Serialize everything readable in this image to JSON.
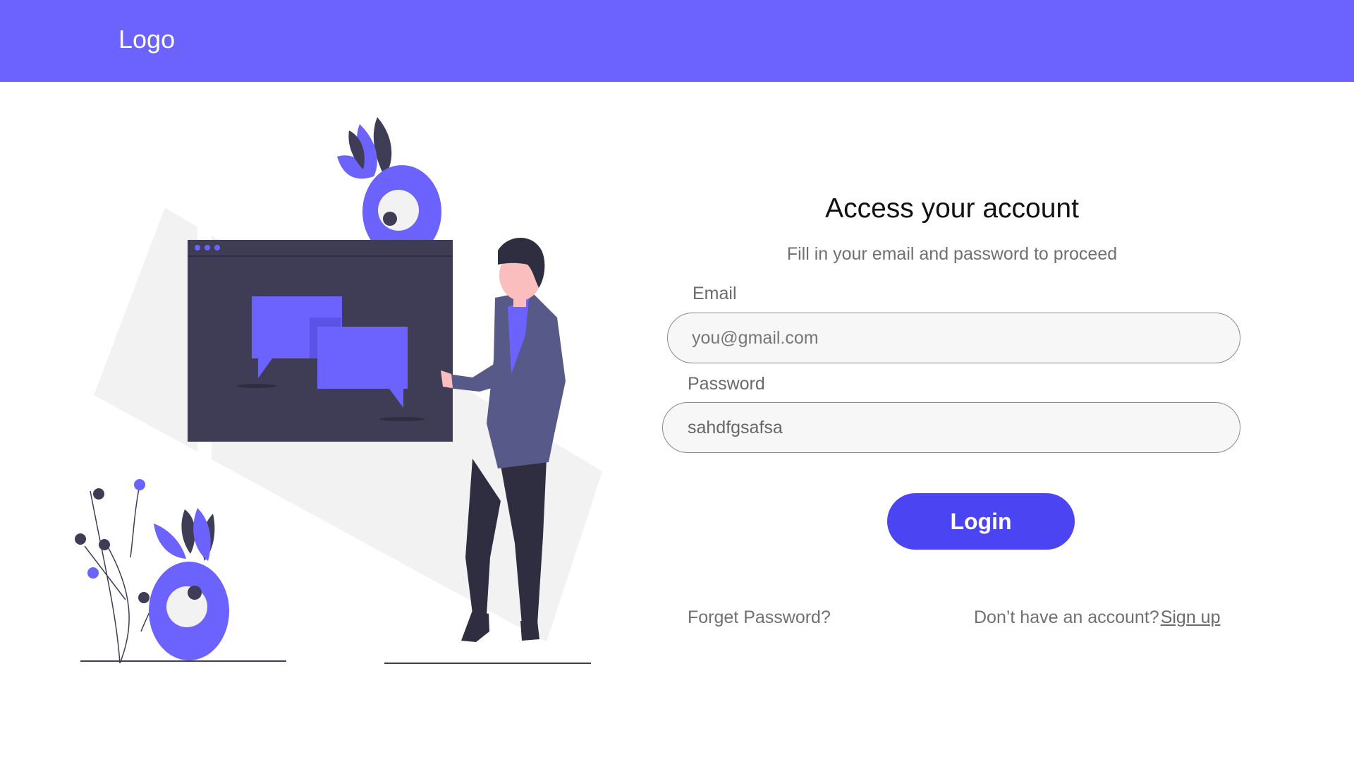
{
  "header": {
    "logo_text": "Logo",
    "background_color": "#6c63ff"
  },
  "form": {
    "title": "Access your account",
    "subtitle": "Fill in your email and password to proceed",
    "email": {
      "label": "Email",
      "placeholder": "you@gmail.com",
      "value": ""
    },
    "password": {
      "label": "Password",
      "placeholder": "",
      "value": "sahdfgsafsa"
    },
    "login_label": "Login",
    "login_color": "#4b44f2",
    "forgot_label": "Forget Password?",
    "signup_prompt": "Don’t have an account?",
    "signup_label": "Sign up"
  },
  "illustration": {
    "icon": "person-with-chat-window-illustration",
    "accent_color": "#6c63ff",
    "dark_color": "#3f3d56"
  }
}
